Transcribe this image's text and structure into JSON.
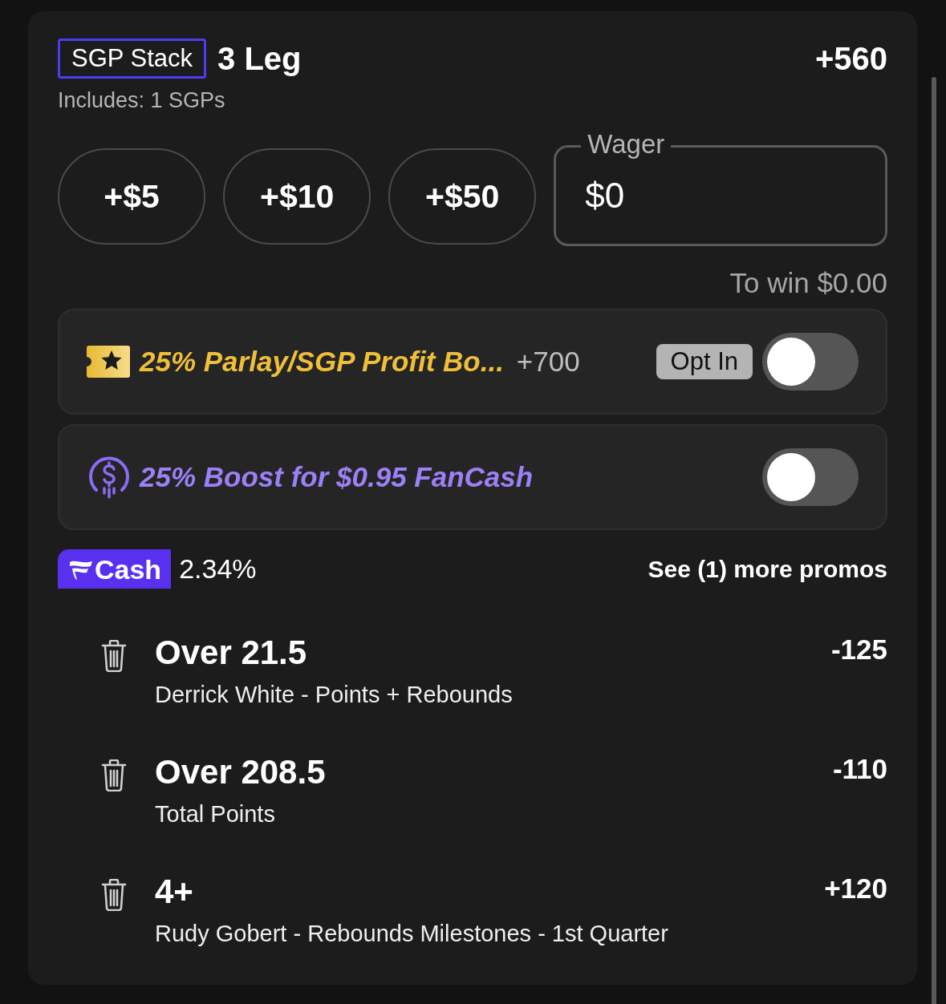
{
  "header": {
    "badge": "SGP Stack",
    "title": "3 Leg",
    "odds": "+560",
    "includes": "Includes: 1 SGPs"
  },
  "stake_buttons": [
    "+$5",
    "+$10",
    "+$50"
  ],
  "wager": {
    "label": "Wager",
    "value": "$0"
  },
  "to_win": "To win $0.00",
  "promos": [
    {
      "kind": "profit",
      "label": "25% Parlay/SGP Profit Bo...",
      "odds": "+700",
      "badge": "Opt In",
      "on": false
    },
    {
      "kind": "fancash",
      "label": "25% Boost for $0.95 FanCash",
      "on": false
    }
  ],
  "fancash": {
    "logo_text": "Cash",
    "rate": "2.34%",
    "more": "See (1) more promos"
  },
  "legs": [
    {
      "title": "Over 21.5",
      "subtitle": "Derrick White - Points + Rebounds",
      "odds": "-125"
    },
    {
      "title": "Over 208.5",
      "subtitle": "Total Points",
      "odds": "-110"
    },
    {
      "title": "4+",
      "subtitle": "Rudy Gobert - Rebounds Milestones - 1st Quarter",
      "odds": "+120"
    }
  ]
}
